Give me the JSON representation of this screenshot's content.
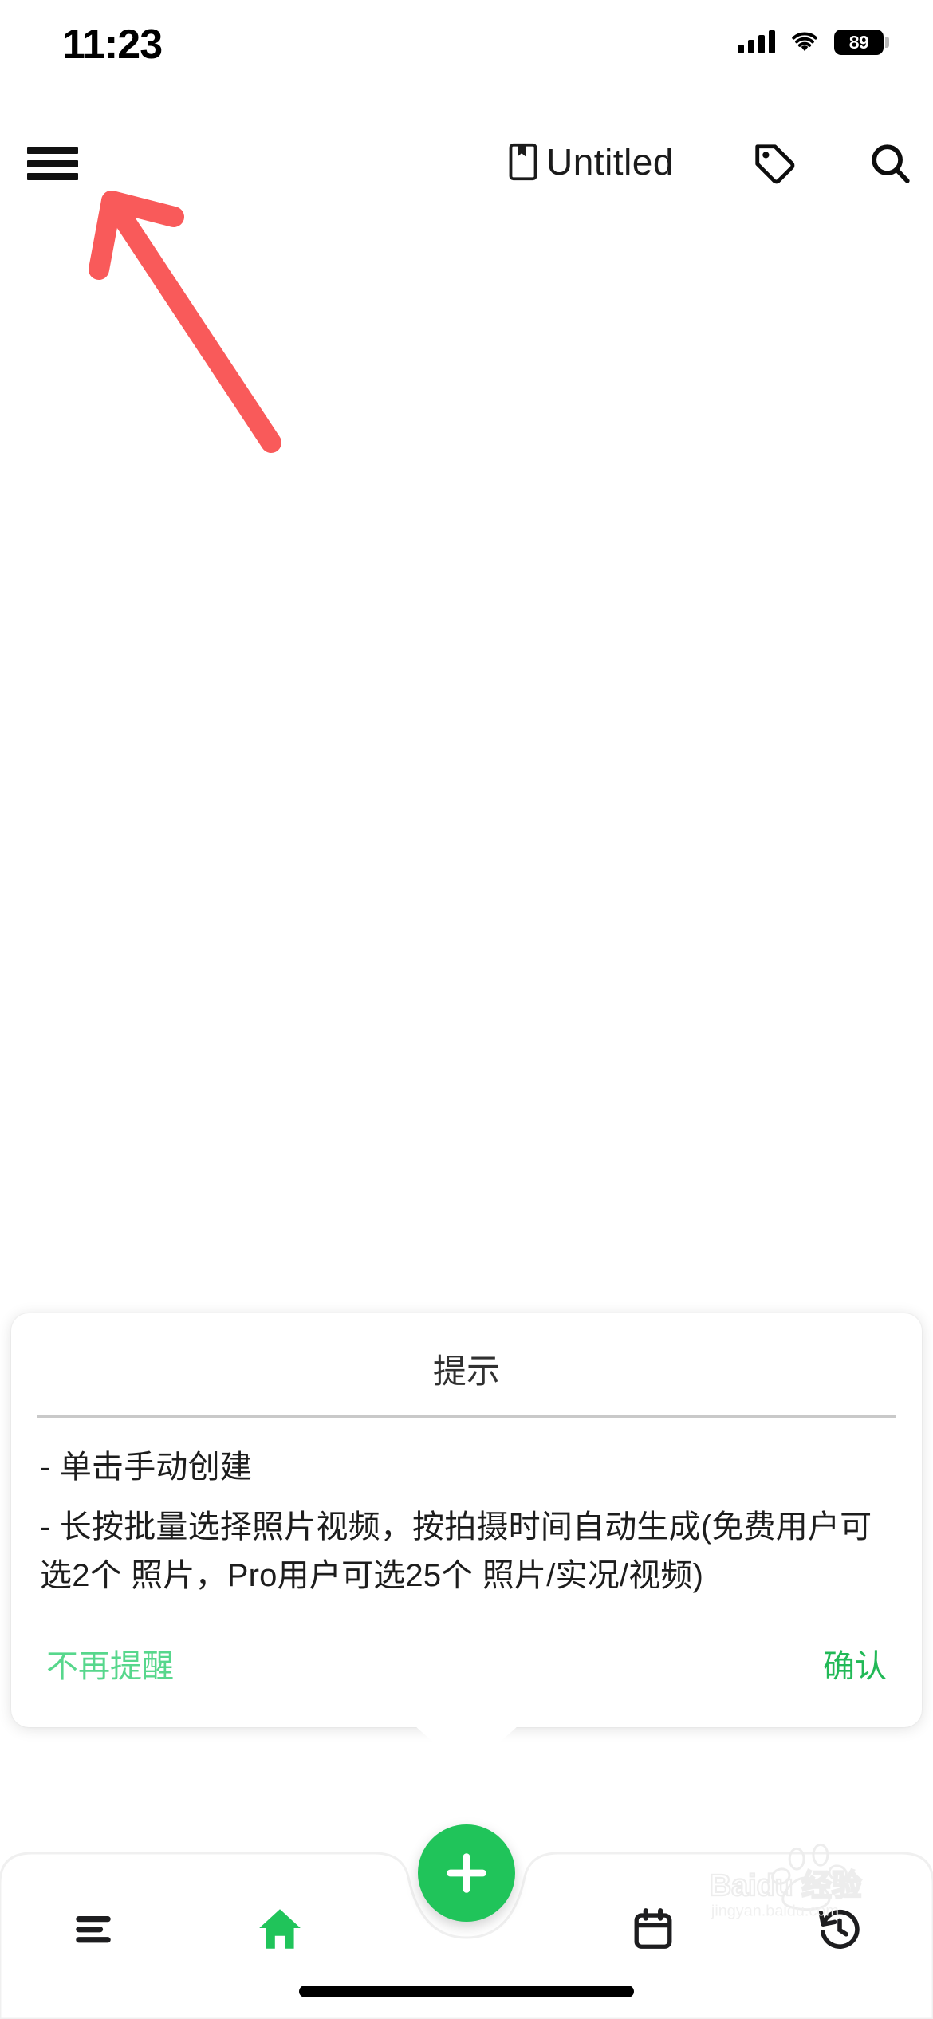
{
  "status_bar": {
    "time": "11:23",
    "battery_level": "89",
    "signal_icon": "cellular-signal-icon",
    "wifi_icon": "wifi-icon",
    "battery_icon": "battery-icon"
  },
  "toolbar": {
    "menu_icon": "hamburger-menu-icon",
    "notebook_icon": "notebook-bookmark-icon",
    "title": "Untitled",
    "tag_icon": "tag-icon",
    "search_icon": "search-icon"
  },
  "annotation": {
    "arrow_color": "#f95a5a",
    "arrow_points_to": "hamburger-menu-icon"
  },
  "dialog": {
    "title": "提示",
    "lines": [
      "- 单击手动创建",
      "- 长按批量选择照片视频，按拍摄时间自动生成(免费用户可选2个 照片，Pro用户可选25个 照片/实况/视频)"
    ],
    "dismiss_label": "不再提醒",
    "confirm_label": "确认",
    "dismiss_color": "#57d78c",
    "confirm_color": "#22b957"
  },
  "bottom_nav": {
    "items": [
      {
        "name": "list-icon",
        "active": false
      },
      {
        "name": "home-icon",
        "active": true
      },
      {
        "name": "calendar-icon",
        "active": false
      },
      {
        "name": "history-icon",
        "active": false
      }
    ],
    "active_color": "#20c45a",
    "inactive_color": "#1d1d1f",
    "fab": {
      "icon": "plus-icon",
      "color": "#20c45a"
    }
  },
  "watermark": {
    "brand": "Baidu 经验",
    "url": "jingyan.baidu.com"
  }
}
